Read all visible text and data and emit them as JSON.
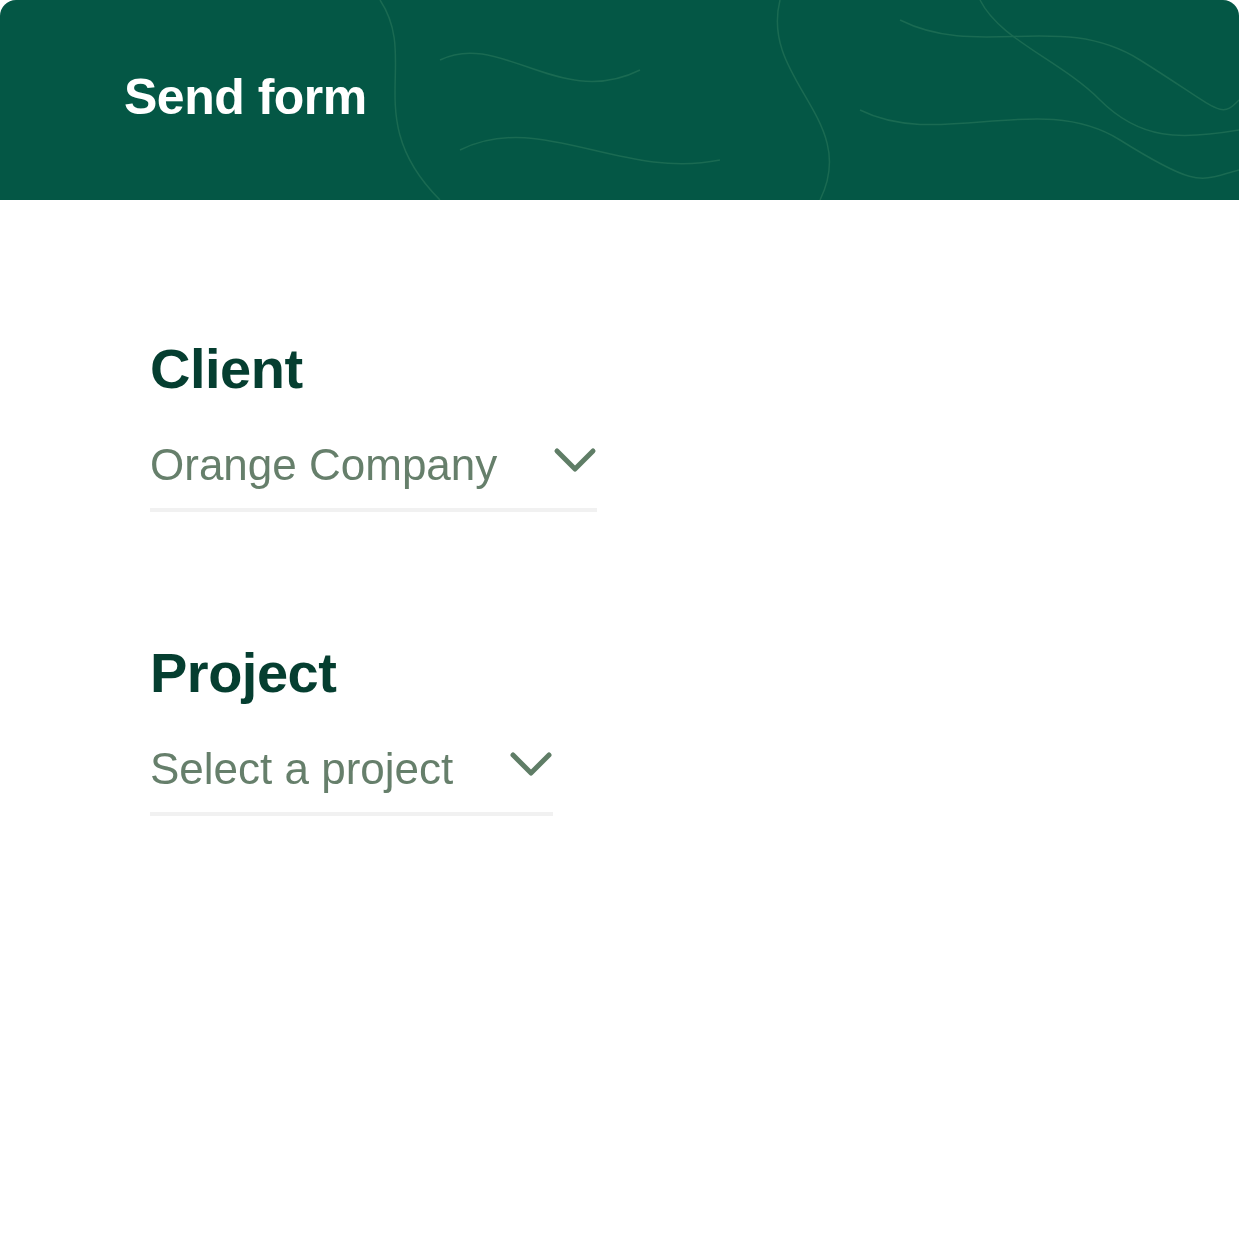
{
  "header": {
    "title": "Send form"
  },
  "fields": [
    {
      "label": "Client",
      "value": "Orange Company"
    },
    {
      "label": "Project",
      "placeholder": "Select a project"
    }
  ]
}
